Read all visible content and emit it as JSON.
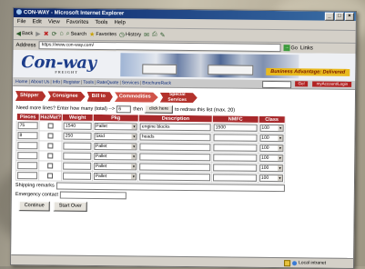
{
  "window": {
    "title": "CON-WAY - Microsoft Internet Explorer"
  },
  "menu": [
    "File",
    "Edit",
    "View",
    "Favorites",
    "Tools",
    "Help"
  ],
  "toolbar": {
    "back": "Back",
    "search": "Search",
    "favorites": "Favorites",
    "history": "History"
  },
  "address": {
    "label": "Address",
    "url": "https://www.con-way.com/",
    "go": "Go",
    "links": "Links"
  },
  "banner": {
    "logo": "Con-way",
    "logo_sub": "FREIGHT",
    "tagline": "Business Advantage: Delivered"
  },
  "nav": {
    "links": [
      "Home",
      "About Us",
      "Info",
      "Register",
      "Tools",
      "RateQuote",
      "Services",
      "BrochureRack"
    ],
    "go": "Go!",
    "login": "myAccount/Login"
  },
  "steps": [
    {
      "label": "Shipper"
    },
    {
      "label": "Consignee"
    },
    {
      "label": "Bill to"
    },
    {
      "label": "Commodities"
    },
    {
      "label": "Special Services"
    }
  ],
  "more_lines": {
    "prefix": "Need more lines? Enter how many (total) -->",
    "value": "6",
    "then": "then",
    "button": "click here",
    "suffix": "to redraw this list (max. 20)"
  },
  "columns": [
    "Pieces",
    "HazMat?",
    "Weight",
    "Pkg",
    "Description",
    "NMFC",
    "Class"
  ],
  "rows": [
    {
      "pieces": "75",
      "weight": "1540",
      "pkg": "Pallet",
      "description": "engine blocks",
      "nmfc": "1500",
      "class": "100"
    },
    {
      "pieces": "8",
      "weight": "250",
      "pkg": "Skid",
      "description": "heads",
      "nmfc": "",
      "class": "100"
    },
    {
      "pieces": "",
      "weight": "",
      "pkg": "Pallet",
      "description": "",
      "nmfc": "",
      "class": "100"
    },
    {
      "pieces": "",
      "weight": "",
      "pkg": "Pallet",
      "description": "",
      "nmfc": "",
      "class": "100"
    },
    {
      "pieces": "",
      "weight": "",
      "pkg": "Pallet",
      "description": "",
      "nmfc": "",
      "class": "100"
    },
    {
      "pieces": "",
      "weight": "",
      "pkg": "Pallet",
      "description": "",
      "nmfc": "",
      "class": "100"
    }
  ],
  "remarks": {
    "shipping": "Shipping remarks",
    "emergency": "Emergency contact"
  },
  "buttons": {
    "continue": "Continue",
    "start_over": "Start Over"
  },
  "status": {
    "zone": "Local intranet"
  }
}
